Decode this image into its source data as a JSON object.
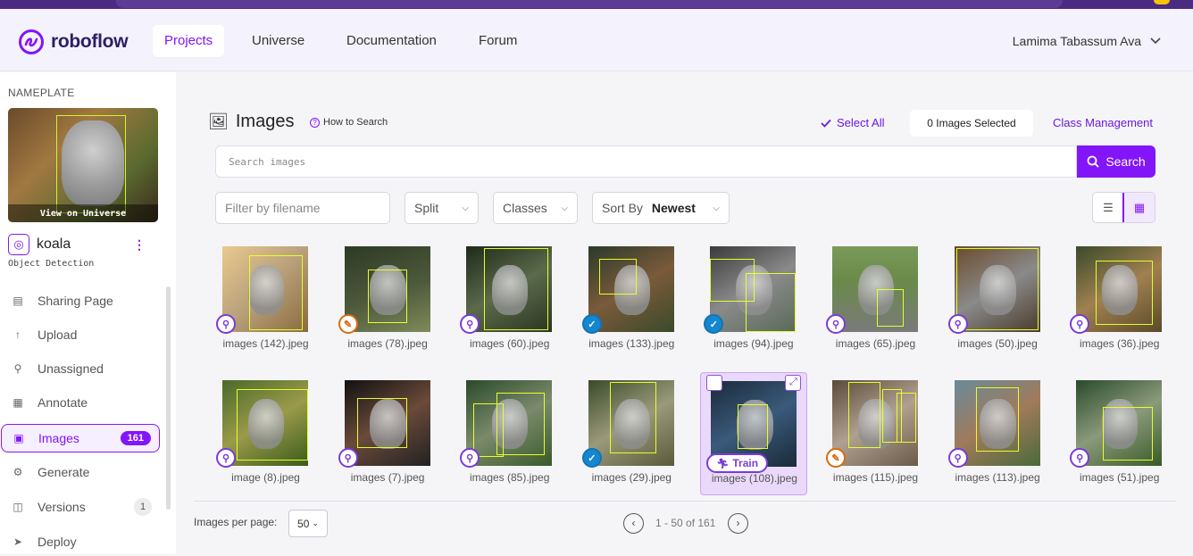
{
  "brand": {
    "name": "roboflow",
    "accent": "#8315f9"
  },
  "nav": {
    "items": [
      "Projects",
      "Universe",
      "Documentation",
      "Forum"
    ],
    "active": "Projects",
    "user": "Lamima Tabassum Ava"
  },
  "sidebar": {
    "workspace": "NAMEPLATE",
    "thumb_caption": "View on Universe",
    "project_name": "koala",
    "project_type": "Object Detection",
    "items": [
      {
        "label": "Sharing Page",
        "icon": "document-icon"
      },
      {
        "label": "Upload",
        "icon": "arrow-up-icon"
      },
      {
        "label": "Unassigned",
        "icon": "search-icon"
      },
      {
        "label": "Annotate",
        "icon": "annotate-icon"
      },
      {
        "label": "Images",
        "icon": "images-icon",
        "badge": "161"
      },
      {
        "label": "Generate",
        "icon": "generate-icon"
      },
      {
        "label": "Versions",
        "icon": "versions-icon",
        "count": "1"
      },
      {
        "label": "Deploy",
        "icon": "rocket-icon"
      }
    ]
  },
  "header": {
    "title": "Images",
    "how_to_search": "How to Search",
    "select_all": "Select All",
    "selected_count": "0 Images Selected",
    "class_management": "Class Management"
  },
  "search": {
    "placeholder": "Search images",
    "button": "Search"
  },
  "filters": {
    "filename_placeholder": "Filter by filename",
    "split": "Split",
    "classes": "Classes",
    "sort_label": "Sort By",
    "sort_value": "Newest"
  },
  "images": [
    {
      "name": "images (142).jpeg",
      "split": "train"
    },
    {
      "name": "images (78).jpeg",
      "split": "test"
    },
    {
      "name": "images (60).jpeg",
      "split": "train"
    },
    {
      "name": "images (133).jpeg",
      "split": "valid"
    },
    {
      "name": "images (94).jpeg",
      "split": "valid"
    },
    {
      "name": "images (65).jpeg",
      "split": "train"
    },
    {
      "name": "images (50).jpeg",
      "split": "train"
    },
    {
      "name": "images (36).jpeg",
      "split": "train"
    },
    {
      "name": "image (8).jpeg",
      "split": "train"
    },
    {
      "name": "images (7).jpeg",
      "split": "train"
    },
    {
      "name": "images (85).jpeg",
      "split": "train"
    },
    {
      "name": "images (29).jpeg",
      "split": "valid"
    },
    {
      "name": "images (108).jpeg",
      "split": "train",
      "hover_label": "Train"
    },
    {
      "name": "images (115).jpeg",
      "split": "test"
    },
    {
      "name": "images (113).jpeg",
      "split": "train"
    },
    {
      "name": "images (51).jpeg",
      "split": "train"
    }
  ],
  "footer": {
    "per_page_label": "Images per page:",
    "per_page_value": "50",
    "range": "1 - 50 of 161"
  }
}
